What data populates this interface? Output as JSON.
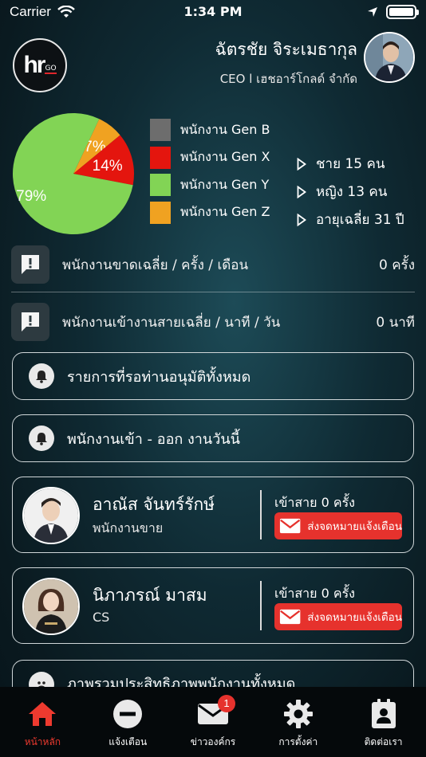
{
  "status_bar": {
    "carrier": "Carrier",
    "time": "1:34 PM"
  },
  "header": {
    "logo_main": "hr",
    "logo_sub": "GO",
    "user_name": "ฉัตรชัย จิระเมธากุล",
    "user_role": "CEO l เฮชอาร์โกลด์ จำกัด"
  },
  "chart_data": {
    "type": "pie",
    "slices": [
      {
        "label": "พนักงาน Gen B",
        "value": 0,
        "display": "",
        "color": "#6d6d6d"
      },
      {
        "label": "พนักงาน Gen X",
        "value": 14,
        "display": "14%",
        "color": "#e4150e"
      },
      {
        "label": "พนักงาน Gen Y",
        "value": 79,
        "display": "79%",
        "color": "#82d455"
      },
      {
        "label": "พนักงาน Gen Z",
        "value": 7,
        "display": "7%",
        "color": "#f0a221"
      }
    ],
    "legend_position": "right"
  },
  "stats": [
    {
      "label": "ชาย 15 คน"
    },
    {
      "label": "หญิง 13 คน"
    },
    {
      "label": "อายุเฉลี่ย 31 ปี"
    }
  ],
  "metrics": [
    {
      "label": "พนักงานขาดเฉลี่ย / ครั้ง / เดือน",
      "value": "0 ครั้ง"
    },
    {
      "label": "พนักงานเข้างานสายเฉลี่ย / นาที / วัน",
      "value": "0 นาที"
    }
  ],
  "menu_pills": [
    {
      "label": "รายการที่รอท่านอนุมัติทั้งหมด"
    },
    {
      "label": "พนักงานเข้า - ออก งานวันนี้"
    }
  ],
  "employees": [
    {
      "name": "อาณัส จันทร์รักษ์",
      "role": "พนักงานขาย",
      "late": "เข้าสาย 0 ครั้ง",
      "button": "ส่งจดหมายแจ้งเตือน"
    },
    {
      "name": "นิภาภรณ์ มาสม",
      "role": "CS",
      "late": "เข้าสาย 0 ครั้ง",
      "button": "ส่งจดหมายแจ้งเตือน"
    }
  ],
  "partial_card": {
    "label": "ภาพรวมประสิทธิภาพพนักงานทั้งหมด"
  },
  "tabbar": {
    "items": [
      {
        "label": "หน้าหลัก",
        "icon": "home-icon",
        "active": true
      },
      {
        "label": "แจ้งเตือน",
        "icon": "minus-circle-icon"
      },
      {
        "label": "ข่าวองค์กร",
        "icon": "mail-icon",
        "badge": "1"
      },
      {
        "label": "การตั้งค่า",
        "icon": "gear-icon"
      },
      {
        "label": "ติดต่อเรา",
        "icon": "contact-icon"
      }
    ],
    "active_color": "#ee3a2f"
  }
}
